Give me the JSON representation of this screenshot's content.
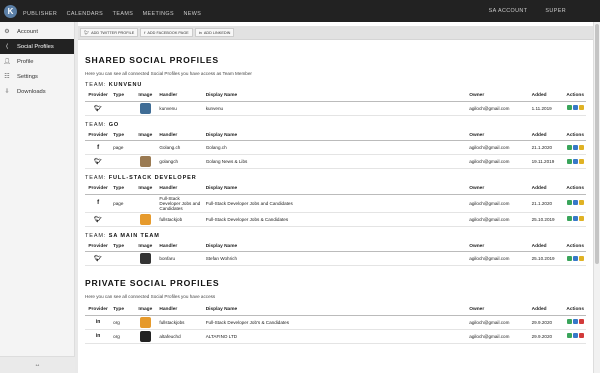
{
  "topbar": {
    "logo": "K",
    "nav": [
      "PUBLISHER",
      "CALENDARS",
      "TEAMS",
      "MEETINGS",
      "NEWS"
    ],
    "account": "SA ACCOUNT",
    "user": "SUPER"
  },
  "sidebar": {
    "items": [
      {
        "label": "Account",
        "icon": "gear-icon"
      },
      {
        "label": "Social Profiles",
        "icon": "share-icon"
      },
      {
        "label": "Profile",
        "icon": "user-icon"
      },
      {
        "label": "Settings",
        "icon": "sliders-icon"
      },
      {
        "label": "Downloads",
        "icon": "download-icon"
      }
    ],
    "collapse": "↔"
  },
  "toolbar": {
    "twitter": "ADD TWITTER PROFILE",
    "facebook": "ADD FACEBOOK PAGE",
    "linkedin": "ADD LINKEDIN"
  },
  "columns": {
    "provider": "Provider",
    "type": "Type",
    "image": "Image",
    "handler": "Handler",
    "display": "Display Name",
    "owner": "Owner",
    "added": "Added",
    "actions": "Actions"
  },
  "shared": {
    "title": "SHARED SOCIAL PROFILES",
    "subtitle": "Here you can see all connected Social Profiles you have access as Team Member",
    "team_label": "TEAM:",
    "teams": [
      {
        "name": "KUNVENU",
        "rows": [
          {
            "provider": "twitter",
            "type": "",
            "handler": "kunvenu",
            "display": "kunvenu",
            "owner": "agiloch@gmail.com",
            "added": "1.11.2019",
            "avatar": "#3f6c95"
          }
        ]
      },
      {
        "name": "GO",
        "rows": [
          {
            "provider": "facebook",
            "type": "page",
            "handler": "Golang.ch",
            "display": "Golang.ch",
            "owner": "agiloch@gmail.com",
            "added": "21.1.2020",
            "avatar": ""
          },
          {
            "provider": "twitter",
            "type": "",
            "handler": "golangch",
            "display": "Golang News & Libs",
            "owner": "agiloch@gmail.com",
            "added": "19.11.2019",
            "avatar": "#9a7a52"
          }
        ]
      },
      {
        "name": "FULL-STACK DEVELOPER",
        "rows": [
          {
            "provider": "facebook",
            "type": "page",
            "handler": "Full-Stack Developer Jobs and Candidates",
            "display": "Full-Stack Developer Jobs and Candidates",
            "owner": "agiloch@gmail.com",
            "added": "21.1.2020",
            "avatar": ""
          },
          {
            "provider": "twitter",
            "type": "",
            "handler": "fullstackjob",
            "display": "Full-Stack Developer Jobs & Candidates",
            "owner": "agiloch@gmail.com",
            "added": "25.10.2019",
            "avatar": "#e69a2c"
          }
        ]
      },
      {
        "name": "SA MAIN TEAM",
        "rows": [
          {
            "provider": "twitter",
            "type": "",
            "handler": "bonfaru",
            "display": "Stefan Wohrich",
            "owner": "agiloch@gmail.com",
            "added": "25.10.2019",
            "avatar": "#333333"
          }
        ]
      }
    ]
  },
  "private": {
    "title": "PRIVATE SOCIAL PROFILES",
    "subtitle": "Here you can see all connected Social Profiles you have access",
    "rows": [
      {
        "provider": "linkedin",
        "type": "org",
        "handler": "fullstackjobs",
        "display": "Full-Stack Developer Job's & Candidates",
        "owner": "agiloch@gmail.com",
        "added": "29.9.2020",
        "avatar": "#e69a2c",
        "delete": true
      },
      {
        "provider": "linkedin",
        "type": "org",
        "handler": "altafeuchd",
        "display": "ALTAFINO LTD",
        "owner": "agiloch@gmail.com",
        "added": "29.9.2020",
        "avatar": "#222222",
        "delete": true
      }
    ]
  }
}
